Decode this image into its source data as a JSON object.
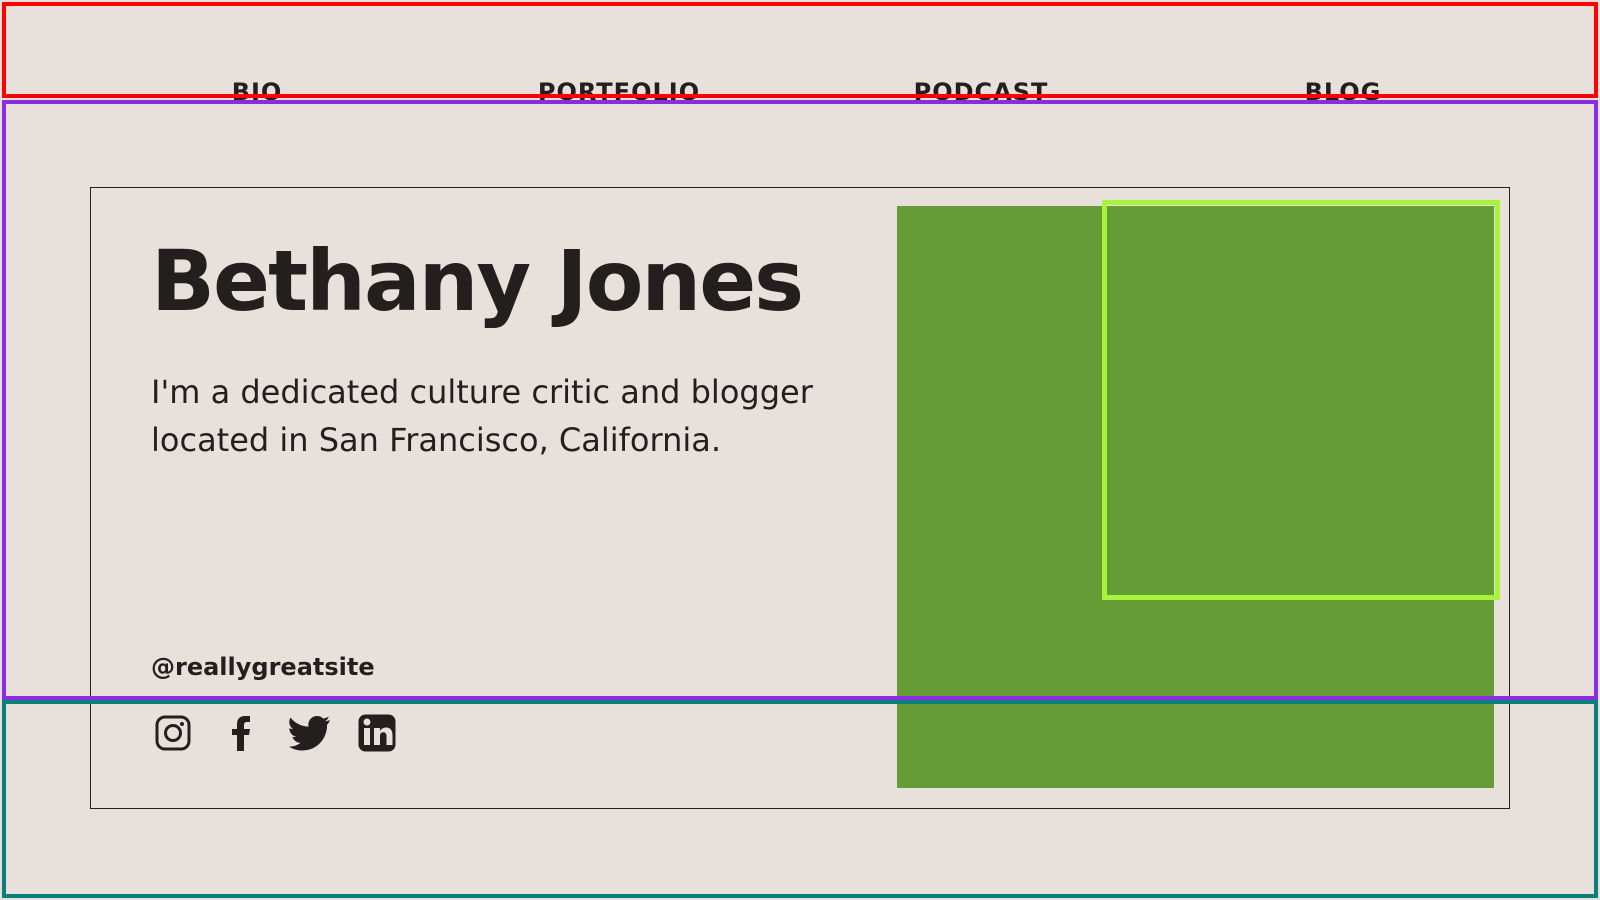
{
  "nav": {
    "items": [
      {
        "label": "BIO"
      },
      {
        "label": "PORTFOLIO"
      },
      {
        "label": "PODCAST"
      },
      {
        "label": "BLOG"
      }
    ]
  },
  "hero": {
    "name": "Bethany Jones",
    "description": "I'm a dedicated culture critic and blogger located in San Francisco, California.",
    "handle": "@reallygreatsite"
  },
  "socials": {
    "icons": [
      {
        "name": "instagram-icon"
      },
      {
        "name": "facebook-icon"
      },
      {
        "name": "twitter-icon"
      },
      {
        "name": "linkedin-icon"
      }
    ]
  },
  "colors": {
    "background": "#e8e0db",
    "text": "#231f1e",
    "photo_fill": "#659c36",
    "focus_outline": "#a7f53a",
    "frame_red": "#ff0000",
    "frame_purple": "#8b2be2",
    "frame_teal": "#0b7f79"
  }
}
